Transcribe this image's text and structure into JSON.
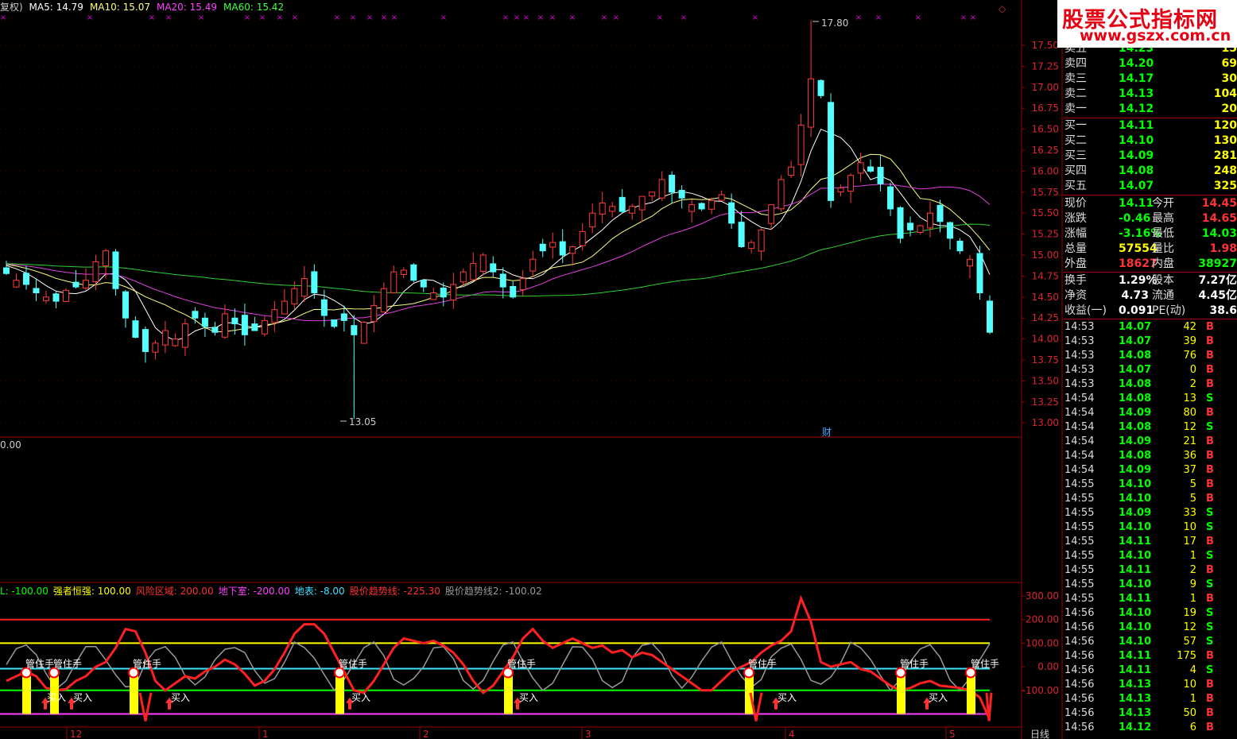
{
  "main_title": {
    "prefix": "复权)",
    "ma": [
      {
        "label": "MA5: 14.79",
        "color": "#ffffff"
      },
      {
        "label": "MA10: 15.07",
        "color": "#ffff80"
      },
      {
        "label": "MA20: 15.49",
        "color": "#ff40ff"
      },
      {
        "label": "MA60: 15.42",
        "color": "#40ff40"
      }
    ]
  },
  "colors": {
    "up": "#ff3c3c",
    "down": "#54ffff",
    "ma5": "#ffffff",
    "ma10": "#ffff80",
    "ma20": "#e040e0",
    "ma60": "#30d030",
    "frame": "#a00000"
  },
  "price_axis": [
    "17.50",
    "17.25",
    "17.00",
    "16.75",
    "16.50",
    "16.25",
    "16.00",
    "15.75",
    "15.50",
    "15.25",
    "15.00",
    "14.75",
    "14.50",
    "14.25",
    "14.00",
    "13.75",
    "13.50",
    "13.25",
    "13.00"
  ],
  "high_label": "17.80",
  "low_label": "13.05",
  "cai_label": "财",
  "sub_zero_label": "0.00",
  "indicator_bar": [
    {
      "label": "L: -100.00",
      "color": "#00ff00"
    },
    {
      "label": "强者恒强: 100.00",
      "color": "#ffff00"
    },
    {
      "label": "风险区域: 200.00",
      "color": "#ff3030"
    },
    {
      "label": "地下室: -200.00",
      "color": "#ff40ff"
    },
    {
      "label": "地表: -8.00",
      "color": "#40e0ff"
    },
    {
      "label": "股价趋势线: -225.30",
      "color": "#ff3030"
    },
    {
      "label": "股价趋势线2: -100.02",
      "color": "#999999"
    }
  ],
  "indicator_axis": [
    "300.00",
    "200.00",
    "100.00",
    "0.00",
    "-100.00"
  ],
  "indicator_labels": {
    "guan": "管住手",
    "buy": "买入"
  },
  "date_axis": [
    "12",
    "1",
    "2",
    "3",
    "4",
    "5"
  ],
  "period_label": "日线",
  "logo": {
    "line1": "股票公式指标网",
    "line2": "www.gszx.com.cn"
  },
  "order_book": [
    {
      "name": "卖五",
      "price": "14.23",
      "vol": "15"
    },
    {
      "name": "卖四",
      "price": "14.20",
      "vol": "69"
    },
    {
      "name": "卖三",
      "price": "14.17",
      "vol": "30"
    },
    {
      "name": "卖二",
      "price": "14.13",
      "vol": "104"
    },
    {
      "name": "卖一",
      "price": "14.12",
      "vol": "20"
    },
    {
      "name": "买一",
      "price": "14.11",
      "vol": "120"
    },
    {
      "name": "买二",
      "price": "14.10",
      "vol": "130"
    },
    {
      "name": "买三",
      "price": "14.09",
      "vol": "281"
    },
    {
      "name": "买四",
      "price": "14.08",
      "vol": "248"
    },
    {
      "name": "买五",
      "price": "14.07",
      "vol": "325"
    }
  ],
  "quote": [
    {
      "k1": "现价",
      "v1": "14.11",
      "c1": "green",
      "k2": "今开",
      "v2": "14.45",
      "c2": "red"
    },
    {
      "k1": "涨跌",
      "v1": "-0.46",
      "c1": "green",
      "k2": "最高",
      "v2": "14.65",
      "c2": "red"
    },
    {
      "k1": "涨幅",
      "v1": "-3.16%",
      "c1": "green",
      "k2": "最低",
      "v2": "14.03",
      "c2": "green"
    },
    {
      "k1": "总量",
      "v1": "57554",
      "c1": "yellow",
      "k2": "量比",
      "v2": "1.98",
      "c2": "red"
    },
    {
      "k1": "外盘",
      "v1": "18627",
      "c1": "red",
      "k2": "内盘",
      "v2": "38927",
      "c2": "green"
    }
  ],
  "fund": [
    {
      "k1": "换手",
      "v1": "1.29%",
      "k2": "股本",
      "v2": "7.27亿"
    },
    {
      "k1": "净资",
      "v1": "4.73",
      "k2": "流通",
      "v2": "4.45亿"
    },
    {
      "k1": "收益(一)",
      "v1": "0.091",
      "k2": "PE(动)",
      "v2": "38.6"
    }
  ],
  "ticks": [
    {
      "t": "14:53",
      "p": "14.07",
      "v": "42",
      "s": "B"
    },
    {
      "t": "14:53",
      "p": "14.07",
      "v": "39",
      "s": "B"
    },
    {
      "t": "14:53",
      "p": "14.08",
      "v": "76",
      "s": "B"
    },
    {
      "t": "14:53",
      "p": "14.07",
      "v": "0",
      "s": "B"
    },
    {
      "t": "14:53",
      "p": "14.08",
      "v": "2",
      "s": "B"
    },
    {
      "t": "14:54",
      "p": "14.08",
      "v": "13",
      "s": "S"
    },
    {
      "t": "14:54",
      "p": "14.09",
      "v": "80",
      "s": "B"
    },
    {
      "t": "14:54",
      "p": "14.08",
      "v": "12",
      "s": "S"
    },
    {
      "t": "14:54",
      "p": "14.09",
      "v": "21",
      "s": "B"
    },
    {
      "t": "14:54",
      "p": "14.08",
      "v": "36",
      "s": "B"
    },
    {
      "t": "14:54",
      "p": "14.09",
      "v": "37",
      "s": "B"
    },
    {
      "t": "14:55",
      "p": "14.10",
      "v": "5",
      "s": "B"
    },
    {
      "t": "14:55",
      "p": "14.10",
      "v": "5",
      "s": "B"
    },
    {
      "t": "14:55",
      "p": "14.09",
      "v": "33",
      "s": "S"
    },
    {
      "t": "14:55",
      "p": "14.10",
      "v": "10",
      "s": "S"
    },
    {
      "t": "14:55",
      "p": "14.11",
      "v": "17",
      "s": "B"
    },
    {
      "t": "14:55",
      "p": "14.10",
      "v": "1",
      "s": "S"
    },
    {
      "t": "14:55",
      "p": "14.11",
      "v": "2",
      "s": "B"
    },
    {
      "t": "14:55",
      "p": "14.10",
      "v": "9",
      "s": "S"
    },
    {
      "t": "14:55",
      "p": "14.11",
      "v": "1",
      "s": "B"
    },
    {
      "t": "14:56",
      "p": "14.10",
      "v": "19",
      "s": "S"
    },
    {
      "t": "14:56",
      "p": "14.10",
      "v": "12",
      "s": "S"
    },
    {
      "t": "14:56",
      "p": "14.10",
      "v": "57",
      "s": "S"
    },
    {
      "t": "14:56",
      "p": "14.11",
      "v": "175",
      "s": "B"
    },
    {
      "t": "14:56",
      "p": "14.11",
      "v": "4",
      "s": "S"
    },
    {
      "t": "14:56",
      "p": "14.13",
      "v": "10",
      "s": "B"
    },
    {
      "t": "14:56",
      "p": "14.13",
      "v": "1",
      "s": "B"
    },
    {
      "t": "14:56",
      "p": "14.13",
      "v": "50",
      "s": "B"
    },
    {
      "t": "14:56",
      "p": "14.12",
      "v": "6",
      "s": "B"
    }
  ]
}
